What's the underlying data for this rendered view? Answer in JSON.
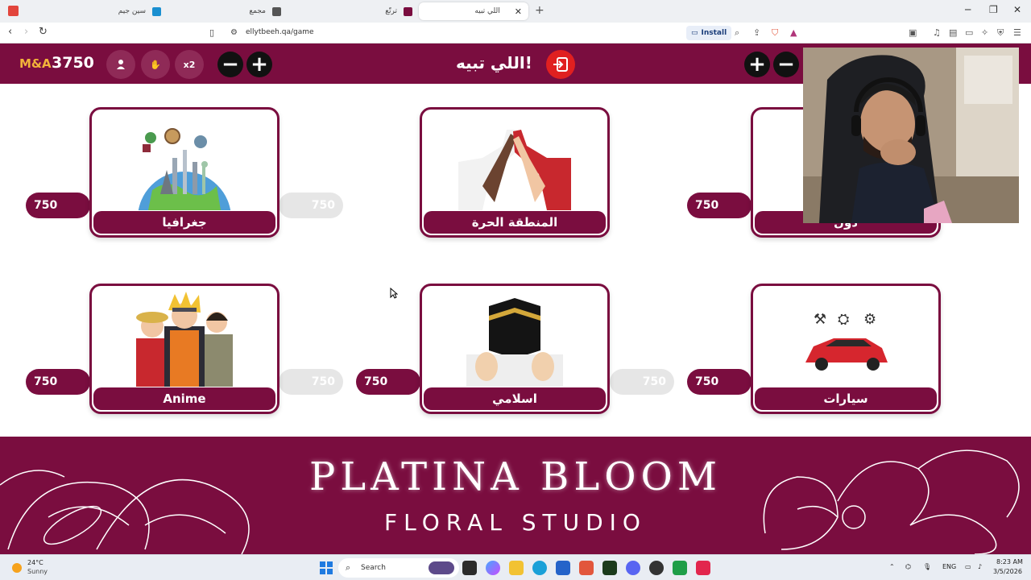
{
  "browser": {
    "tabs": [
      {
        "label": "سين جيم",
        "active": false
      },
      {
        "label": "مجمع",
        "active": false
      },
      {
        "label": "ترتّع",
        "active": false
      },
      {
        "label": "اللي تبيه",
        "active": true
      }
    ],
    "url": "ellytbeeh.qa/game",
    "install_label": "Install"
  },
  "header": {
    "team_name": "M&A",
    "team_score": "3750",
    "double_label": "x2",
    "logo_text": "اللي تبيه!"
  },
  "board": {
    "cards": [
      {
        "label": "جغرافيا",
        "points_left": "750",
        "points_right": "750"
      },
      {
        "label": "المنطقة الحرة",
        "points_left": "",
        "points_right": ""
      },
      {
        "label": "دول",
        "points_left": "750",
        "points_right": ""
      },
      {
        "label": "Anime",
        "points_left": "750",
        "points_right": "750"
      },
      {
        "label": "اسلامي",
        "points_left": "750",
        "points_right": "750"
      },
      {
        "label": "سيارات",
        "points_left": "750",
        "points_right": ""
      }
    ]
  },
  "banner": {
    "title": "PLATINA BLOOM",
    "subtitle": "FLORAL STUDIO"
  },
  "taskbar": {
    "weather_temp": "24°C",
    "weather_desc": "Sunny",
    "search_placeholder": "Search",
    "lang": "ENG",
    "time": "8:23 AM",
    "date": "3/5/2026"
  },
  "colors": {
    "brand": "#7a0d3f",
    "accent": "#f2b33a",
    "exit": "#e02020"
  }
}
